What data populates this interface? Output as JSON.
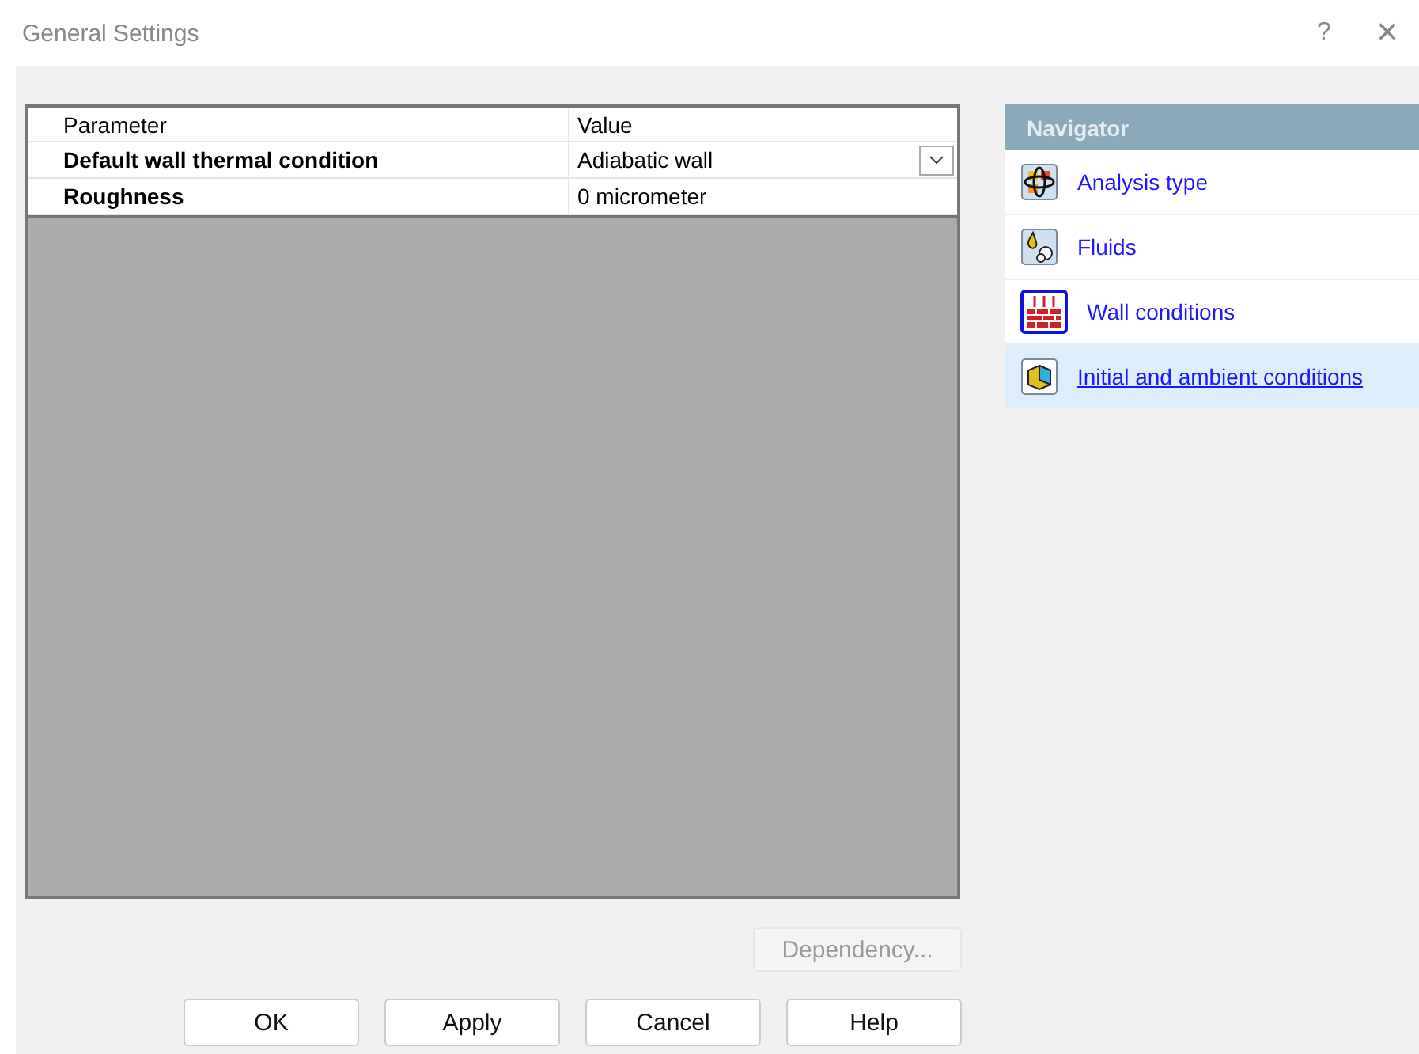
{
  "window": {
    "title": "General Settings",
    "help": "?",
    "close": "×"
  },
  "table": {
    "columns": [
      "Parameter",
      "Value"
    ],
    "rows": [
      {
        "parameter": "Default wall thermal condition",
        "value": "Adiabatic wall",
        "dropdown": true
      },
      {
        "parameter": "Roughness",
        "value": "0 micrometer",
        "dropdown": false
      }
    ]
  },
  "navigator": {
    "title": "Navigator",
    "items": [
      {
        "label": "Analysis type",
        "kind": "analysis",
        "selected": false
      },
      {
        "label": "Fluids",
        "kind": "fluids",
        "selected": false
      },
      {
        "label": "Wall conditions",
        "kind": "wall",
        "selected": false
      },
      {
        "label": "Initial and ambient conditions",
        "kind": "initial",
        "selected": true
      }
    ]
  },
  "dependency_button": {
    "label": "Dependency...",
    "disabled": true
  },
  "buttons": [
    "OK",
    "Apply",
    "Cancel",
    "Help"
  ]
}
